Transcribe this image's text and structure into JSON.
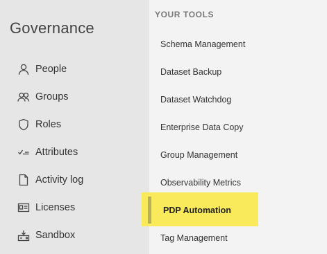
{
  "governance": {
    "title": "Governance",
    "nav": [
      {
        "label": "People",
        "icon": "person-icon"
      },
      {
        "label": "Groups",
        "icon": "group-icon"
      },
      {
        "label": "Roles",
        "icon": "shield-icon"
      },
      {
        "label": "Attributes",
        "icon": "checklist-icon"
      },
      {
        "label": "Activity log",
        "icon": "document-icon"
      },
      {
        "label": "Licenses",
        "icon": "id-card-icon"
      },
      {
        "label": "Sandbox",
        "icon": "sandbox-icon"
      }
    ]
  },
  "tools": {
    "section_title": "YOUR TOOLS",
    "items": [
      {
        "label": "Schema Management"
      },
      {
        "label": "Dataset Backup"
      },
      {
        "label": "Dataset Watchdog"
      },
      {
        "label": "Enterprise Data Copy"
      },
      {
        "label": "Group Management"
      },
      {
        "label": "Observability Metrics"
      },
      {
        "label": "PDP Automation",
        "selected": true
      },
      {
        "label": "Tag Management"
      }
    ],
    "highlight_color": "#f8ea5a"
  }
}
